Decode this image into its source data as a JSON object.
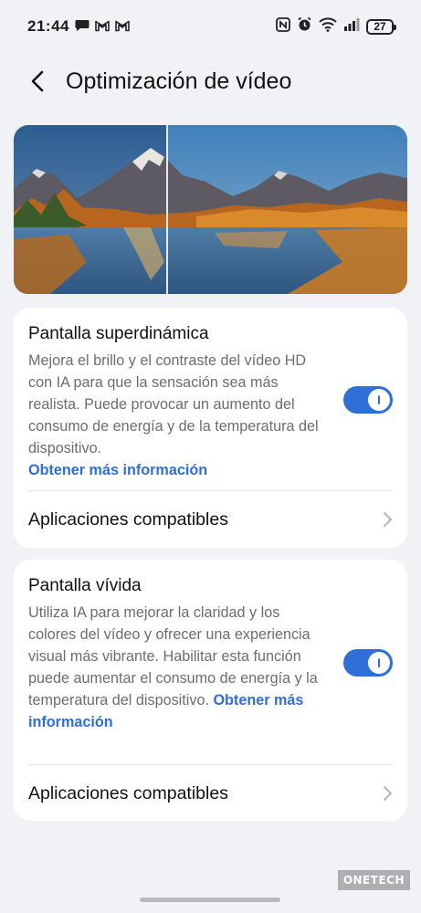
{
  "status_bar": {
    "time": "21:44",
    "left_icons": [
      "chat-bubble-icon",
      "gmail-icon",
      "gmail-icon"
    ],
    "right_icons": [
      "nfc-icon",
      "alarm-icon",
      "wifi-icon",
      "signal-icon"
    ],
    "battery": "27"
  },
  "header": {
    "title": "Optimización de vídeo"
  },
  "colors": {
    "accent": "#2f6fd8",
    "background": "#f1f2f6",
    "card": "#ffffff"
  },
  "cards": [
    {
      "title": "Pantalla superdinámica",
      "description": "Mejora el brillo y el contraste del vídeo HD con IA para que la sensación sea más realista. Puede provocar un aumento del consumo de energía y de la temperatura del dispositivo.",
      "link": "Obtener más información",
      "toggle_on": true,
      "nav_label": "Aplicaciones compatibles"
    },
    {
      "title": "Pantalla vívida",
      "description": "Utiliza IA para mejorar la claridad y los colores del vídeo y ofrecer una experiencia visual más vibrante. Habilitar esta función puede aumentar el consumo de energía y la temperatura del dispositivo.",
      "link": "Obtener más información",
      "toggle_on": true,
      "nav_label": "Aplicaciones compatibles"
    }
  ],
  "watermark": "ONETECH"
}
